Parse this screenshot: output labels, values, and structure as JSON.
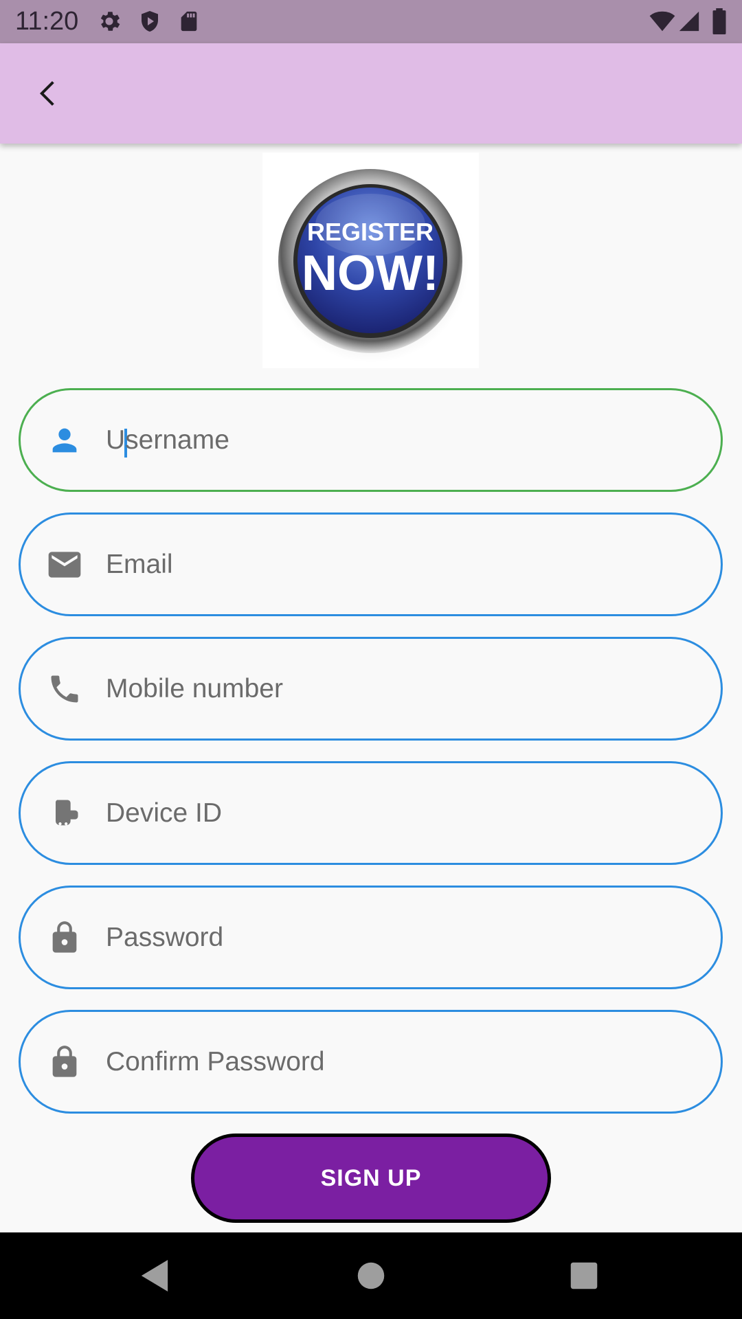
{
  "status_bar": {
    "time": "11:20",
    "left_icons": [
      "gear-icon",
      "shield-icon",
      "sd-card-icon"
    ],
    "right_icons": [
      "wifi-icon",
      "signal-icon",
      "battery-icon"
    ]
  },
  "app_bar": {
    "back_icon": "chevron-left-icon",
    "background": "#e0bce6"
  },
  "logo": {
    "line1": "REGISTER",
    "line2": "NOW!"
  },
  "form": {
    "fields": [
      {
        "placeholder": "Username",
        "value": "",
        "icon": "person-icon",
        "focused": true
      },
      {
        "placeholder": "Email",
        "value": "",
        "icon": "mail-icon",
        "focused": false
      },
      {
        "placeholder": "Mobile number",
        "value": "",
        "icon": "phone-icon",
        "focused": false
      },
      {
        "placeholder": "Device ID",
        "value": "",
        "icon": "device-icon",
        "focused": false
      },
      {
        "placeholder": "Password",
        "value": "",
        "icon": "lock-icon",
        "focused": false
      },
      {
        "placeholder": "Confirm Password",
        "value": "",
        "icon": "lock-icon",
        "focused": false
      }
    ],
    "focus_color": "#4caf50",
    "border_color": "#2c8de0"
  },
  "signup": {
    "label": "SIGN UP",
    "color": "#7b1fa2"
  },
  "nav_bar": {
    "icons": [
      "back-triangle-icon",
      "home-circle-icon",
      "recents-square-icon"
    ]
  }
}
